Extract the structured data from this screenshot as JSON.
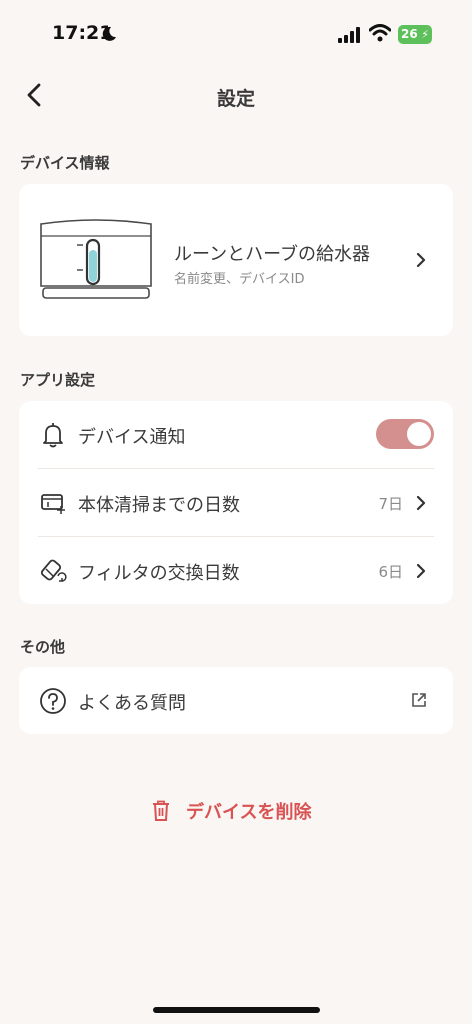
{
  "status": {
    "time": "17:21",
    "battery": "26"
  },
  "header": {
    "title": "設定"
  },
  "device_section": {
    "title": "デバイス情報",
    "device_name": "ルーンとハーブの給水器",
    "device_sub": "名前変更、デバイスID"
  },
  "app_section": {
    "title": "アプリ設定",
    "rows": [
      {
        "label": "デバイス通知",
        "toggle_on": true
      },
      {
        "label": "本体清掃までの日数",
        "value": "7日"
      },
      {
        "label": "フィルタの交換日数",
        "value": "6日"
      }
    ]
  },
  "other_section": {
    "title": "その他",
    "faq_label": "よくある質問"
  },
  "delete_label": "デバイスを削除",
  "colors": {
    "accent": "#D4908E",
    "danger": "#D85454",
    "background": "#FAF6F3"
  }
}
